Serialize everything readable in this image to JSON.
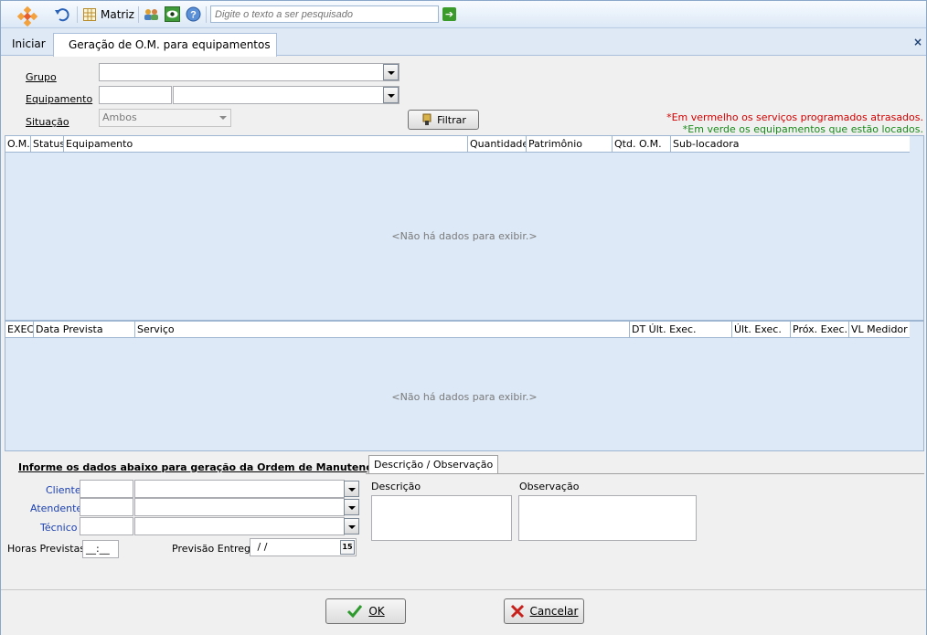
{
  "toolbar": {
    "matriz_label": "Matriz",
    "search_placeholder": "Digite o texto a ser pesquisado",
    "icons": [
      "app-logo-icon",
      "undo-icon",
      "grid-icon",
      "users-icon",
      "eye-icon",
      "help-icon",
      "go-arrow-icon"
    ]
  },
  "tabs": {
    "home": "Iniciar",
    "active": "Geração de O.M. para equipamentos",
    "close": "×"
  },
  "filters": {
    "grupo_label": "Grupo",
    "equipamento_label": "Equipamento",
    "situacao_label": "Situação",
    "situacao_value": "Ambos",
    "filter_button": "Filtrar"
  },
  "notes": {
    "red": "*Em vermelho os serviços programados atrasados.",
    "green": "*Em verde os equipamentos que estão locados."
  },
  "grid1": {
    "columns": [
      "O.M.",
      "Status",
      "Equipamento",
      "Quantidade",
      "Patrimônio",
      "Qtd. O.M.",
      "Sub-locadora"
    ],
    "empty": "<Não há dados para exibir.>"
  },
  "grid2": {
    "columns": [
      "EXEC",
      "Data Prevista",
      "Serviço",
      "DT Últ. Exec.",
      "Últ. Exec.",
      "Próx. Exec.",
      "VL Medidor"
    ],
    "empty": "<Não há dados para exibir.>"
  },
  "om_form": {
    "title": "Informe os dados abaixo para geração da Ordem de Manutenção:",
    "cliente_label": "Cliente",
    "atendente_label": "Atendente",
    "tecnico_label": "Técnico",
    "horas_label": "Horas Previstas",
    "horas_value": "__:__",
    "previsao_label": "Previsão Entrega",
    "previsao_value": " / /",
    "calendar_label": "15",
    "tab_label": "Descrição / Observação",
    "descricao_label": "Descrição",
    "observacao_label": "Observação"
  },
  "footer": {
    "ok_label": "OK",
    "cancel_label": "Cancelar"
  },
  "colors": {
    "red_note": "#d40000",
    "green_note": "#1a8a1a",
    "grid_bg": "#dde9f7",
    "field_label_blue": "#1a3fb0"
  }
}
